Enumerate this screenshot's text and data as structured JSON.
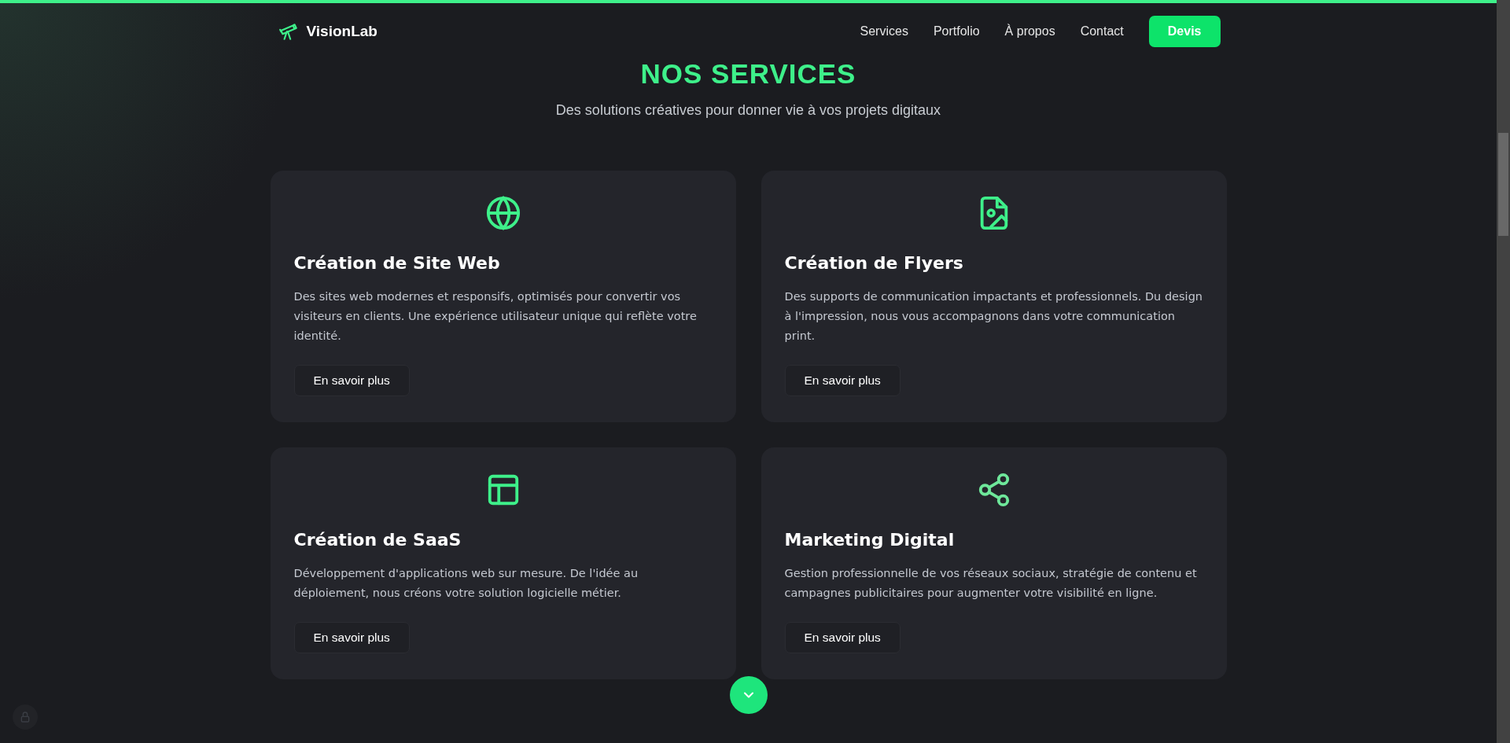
{
  "header": {
    "logo": "VisionLab",
    "nav": [
      {
        "label": "Services"
      },
      {
        "label": "Portfolio"
      },
      {
        "label": "À propos"
      },
      {
        "label": "Contact"
      }
    ],
    "cta": "Devis"
  },
  "section": {
    "title": "NOS SERVICES",
    "subtitle": "Des solutions créatives pour donner vie à vos projets digitaux"
  },
  "services": [
    {
      "kind": "globe",
      "title": "Création de Site Web",
      "description": "Des sites web modernes et responsifs, optimisés pour convertir vos visiteurs en clients. Une expérience utilisateur unique qui reflète votre identité.",
      "button": "En savoir plus"
    },
    {
      "kind": "image",
      "title": "Création de Flyers",
      "description": "Des supports de communication impactants et professionnels. Du design à l'impression, nous vous accompagnons dans votre communication print.",
      "button": "En savoir plus"
    },
    {
      "kind": "layout",
      "title": "Création de SaaS",
      "description": "Développement d'applications web sur mesure. De l'idée au déploiement, nous créons votre solution logicielle métier.",
      "button": "En savoir plus"
    },
    {
      "kind": "share",
      "title": "Marketing Digital",
      "description": "Gestion professionnelle de vos réseaux sociaux, stratégie de contenu et campagnes publicitaires pour augmenter votre visibilité en ligne.",
      "button": "En savoir plus"
    }
  ]
}
